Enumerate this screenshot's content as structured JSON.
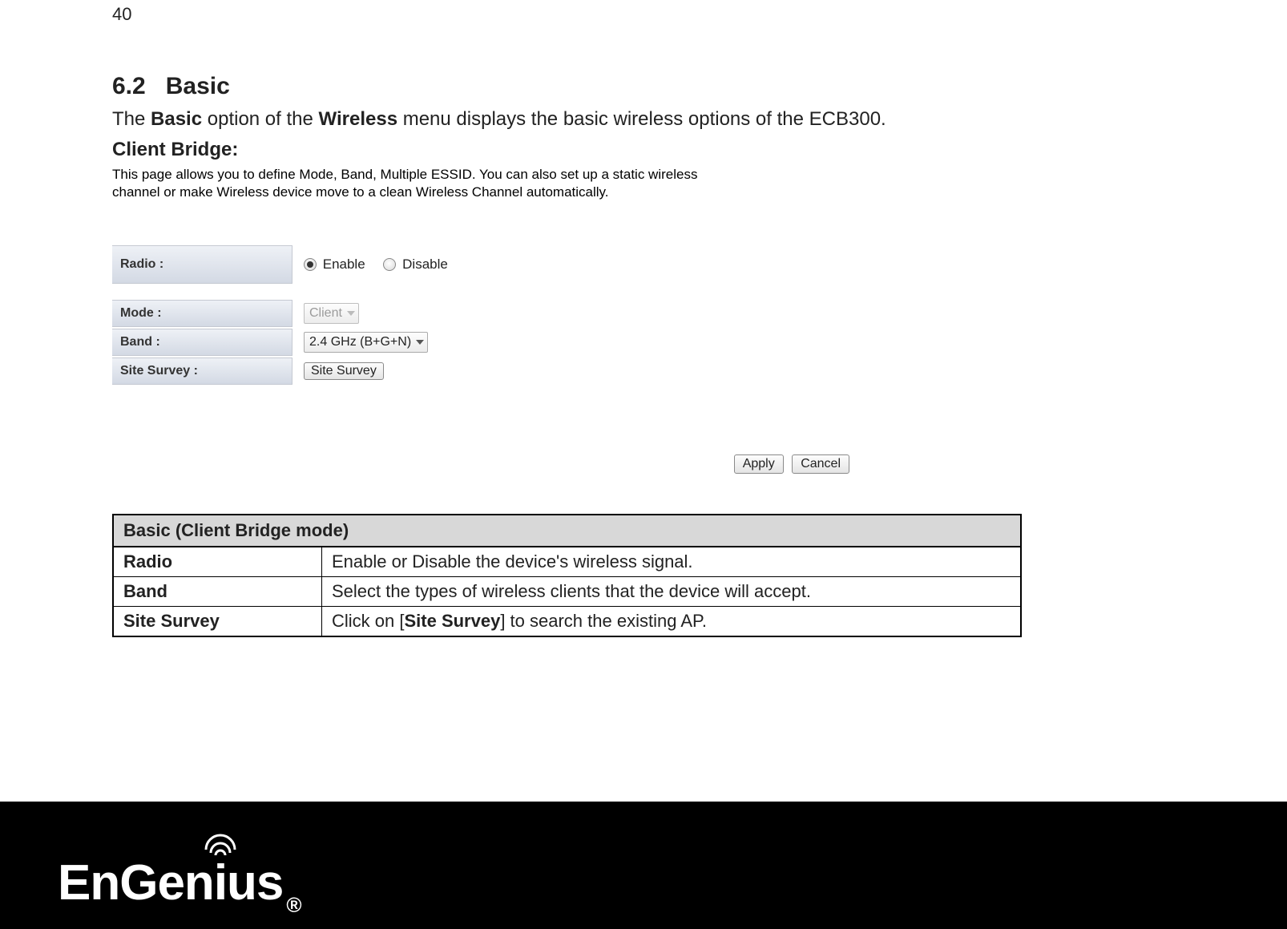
{
  "page_number": "40",
  "section_number": "6.2",
  "section_title": "Basic",
  "intro": {
    "pre": "The ",
    "b1": "Basic",
    "mid": " option of the ",
    "b2": "Wireless",
    "post": " menu displays the basic wireless options of the ECB300."
  },
  "subheading": "Client Bridge:",
  "panel_description": "This page allows you to define Mode, Band, Multiple ESSID. You can also set up a static wireless channel or make Wireless device move to a clean Wireless Channel automatically.",
  "form": {
    "radio_label": "Radio :",
    "radio_enable": "Enable",
    "radio_disable": "Disable",
    "mode_label": "Mode :",
    "mode_value": "Client",
    "band_label": "Band :",
    "band_value": "2.4 GHz (B+G+N)",
    "site_survey_label": "Site Survey :",
    "site_survey_btn": "Site Survey",
    "apply_btn": "Apply",
    "cancel_btn": "Cancel"
  },
  "table": {
    "header": "Basic (Client Bridge mode)",
    "rows": [
      {
        "key": "Radio",
        "val": "Enable or Disable the device's wireless signal."
      },
      {
        "key": "Band",
        "val": "Select the types of wireless clients that the device will accept."
      },
      {
        "key": "Site Survey",
        "val_pre": "Click on [",
        "val_b": "Site Survey",
        "val_post": "] to search the existing AP."
      }
    ]
  },
  "logo": {
    "pre": "EnGen",
    "i": "i",
    "post": "us",
    "reg": "®"
  }
}
